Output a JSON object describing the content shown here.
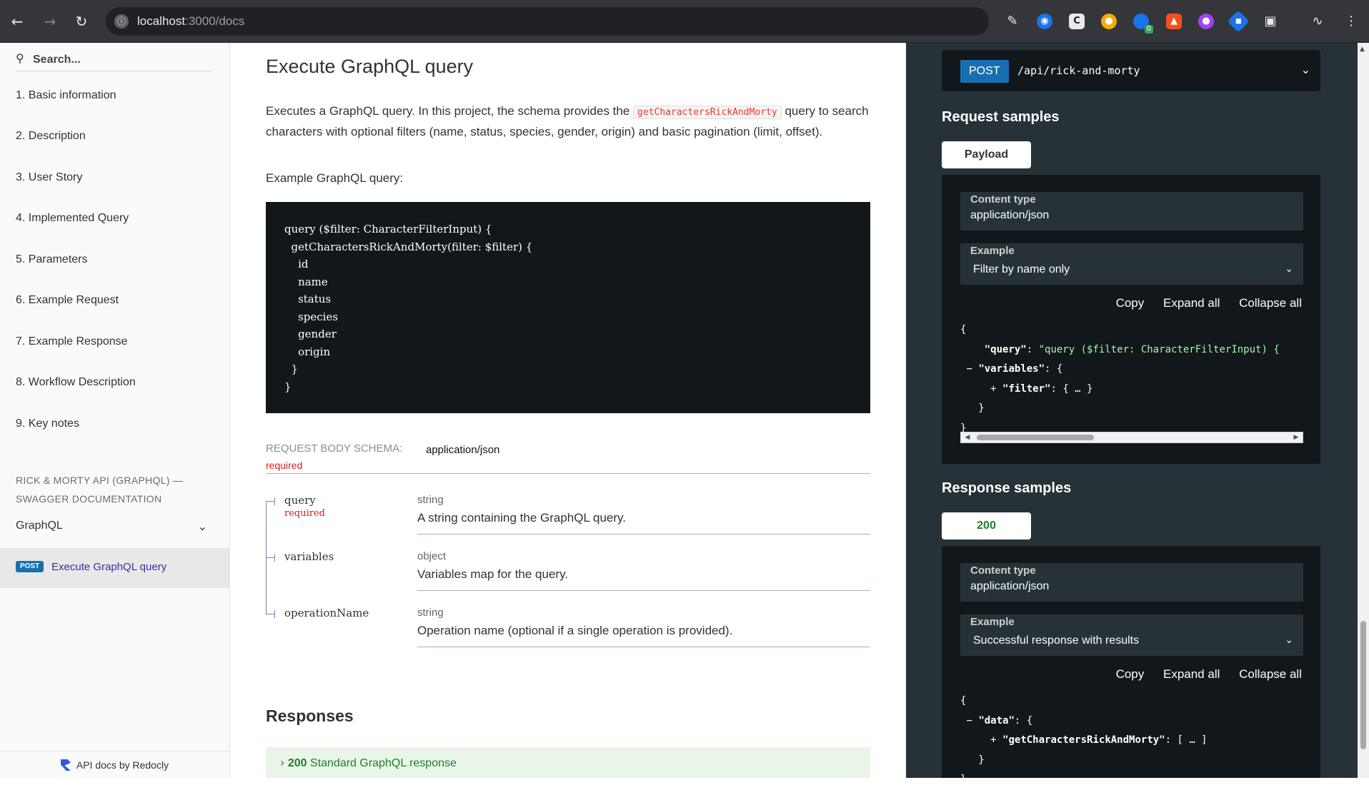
{
  "browser": {
    "url_host": "localhost",
    "url_path": ":3000/docs",
    "ext_badge": "0"
  },
  "sidebar": {
    "search_placeholder": "Search...",
    "items": [
      "1. Basic information",
      "2. Description",
      "3. User Story",
      "4. Implemented Query",
      "5. Parameters",
      "6. Example Request",
      "7. Example Response",
      "8. Workflow Description",
      "9. Key notes"
    ],
    "section_title": "RICK & MORTY API (GRAPHQL) — SWAGGER DOCUMENTATION",
    "group": "GraphQL",
    "active_op": {
      "method": "POST",
      "label": "Execute GraphQL query"
    },
    "powered_by": "API docs by Redocly"
  },
  "main": {
    "title": "Execute GraphQL query",
    "desc_before": "Executes a GraphQL query. In this project, the schema provides the ",
    "desc_code": "getCharactersRickAndMorty",
    "desc_after": " query to search characters with optional filters (name, status, species, gender, origin) and basic pagination (limit, offset).",
    "example_label": "Example GraphQL query:",
    "code_lines": [
      "query ($filter: CharacterFilterInput) {",
      "  getCharactersRickAndMorty(filter: $filter) {",
      "    id",
      "    name",
      "    status",
      "    species",
      "    gender",
      "    origin",
      "  }",
      "}"
    ],
    "schema": {
      "label": "Request Body schema:",
      "content_type": "application/json",
      "required": "required"
    },
    "properties": [
      {
        "name": "query",
        "required": "required",
        "type": "string",
        "description": "A string containing the GraphQL query."
      },
      {
        "name": "variables",
        "required": "",
        "type": "object",
        "description": "Variables map for the query."
      },
      {
        "name": "operationName",
        "required": "",
        "type": "string",
        "description": "Operation name (optional if a single operation is provided)."
      }
    ],
    "responses_title": "Responses",
    "response_200": {
      "code": "200",
      "label": "Standard GraphQL response"
    }
  },
  "right_panel": {
    "method": "POST",
    "path": "/api/rick-and-morty",
    "request_title": "Request samples",
    "request_tab": "Payload",
    "response_title": "Response samples",
    "response_tab": "200",
    "content_type_label": "Content type",
    "content_type_value": "application/json",
    "example_label": "Example",
    "request_example": "Filter by name only",
    "response_example": "Successful response with results",
    "copy": "Copy",
    "expand_all": "Expand all",
    "collapse_all": "Collapse all"
  },
  "colors": {
    "post_badge": "#186fb0",
    "dark_panel": "#263238",
    "code_bg": "#11171a",
    "string_green": "#a0fbaa",
    "required_red": "#d41f1c",
    "success_green": "#1d8127"
  }
}
